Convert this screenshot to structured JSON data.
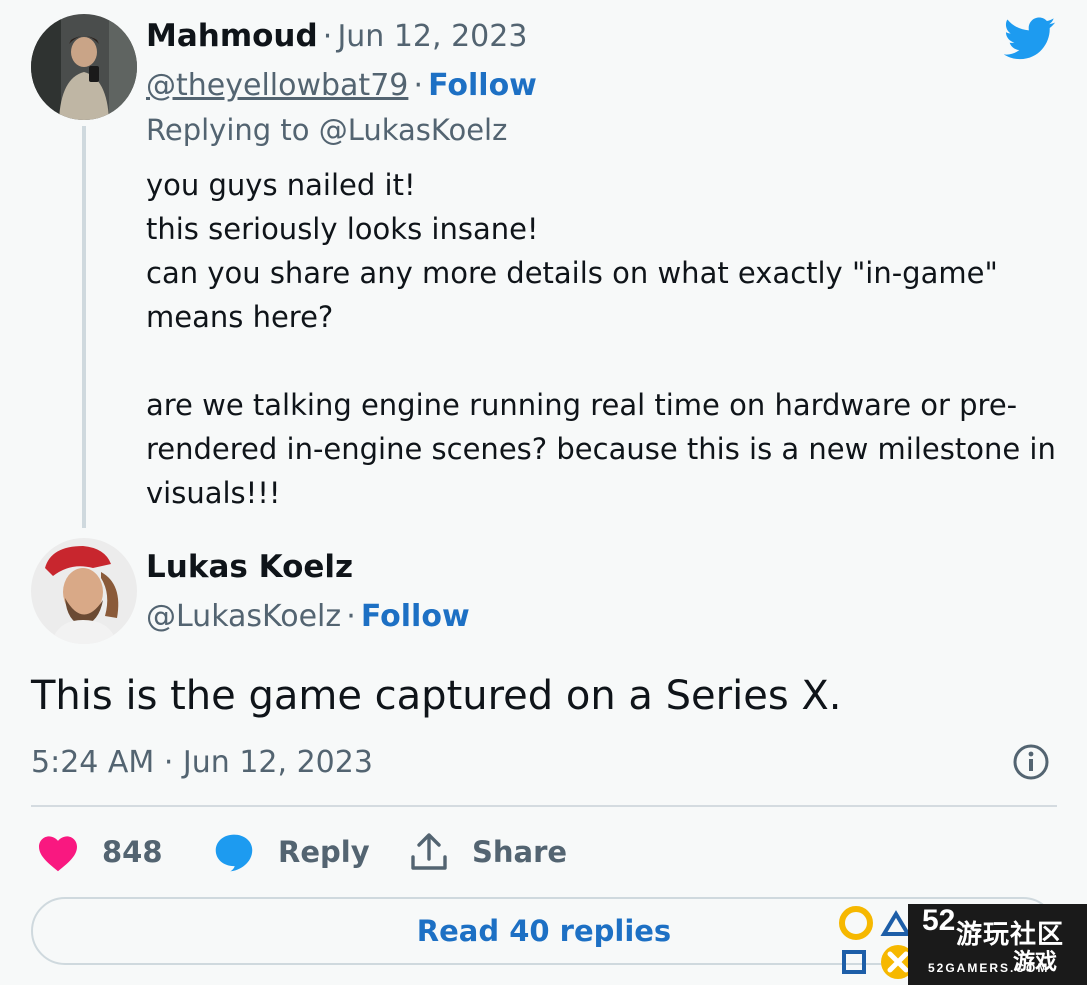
{
  "reply_tweet": {
    "author_name": "Mahmoud",
    "separator": "·",
    "date": "Jun 12, 2023",
    "handle": "@theyellowbat79",
    "follow_label": "Follow",
    "replying_to": "Replying to @LukasKoelz",
    "body_lines": [
      "you guys nailed it!",
      "this seriously looks insane!",
      "can you share any more details on what exactly \"in-game\"",
      "means here?",
      "",
      "are we talking engine running real time on hardware or pre-",
      "rendered in-engine scenes? because this is a new milestone in",
      "visuals!!!"
    ]
  },
  "main_tweet": {
    "author_name": "Lukas Koelz",
    "handle": "@LukasKoelz",
    "separator": "·",
    "follow_label": "Follow",
    "text": "This is the game captured on a Series X.",
    "timestamp": "5:24 AM · Jun 12, 2023"
  },
  "actions": {
    "like_count": "848",
    "reply_label": "Reply",
    "share_label": "Share"
  },
  "read_replies_label": "Read 40 replies",
  "watermark": {
    "number": "52",
    "name_cn": "游玩社区",
    "name_cn2": "游戏",
    "site": "52GAMERS.COM"
  },
  "icons": {
    "brand": "twitter-bird-icon",
    "info": "info-icon",
    "like": "heart-icon",
    "reply": "speech-bubble-icon",
    "share": "share-upload-icon"
  },
  "colors": {
    "twitter_blue": "#1d9bf0",
    "link_blue": "#1d70c4",
    "heart_pink": "#f91880",
    "reply_blue": "#1d9bf0",
    "muted_text": "#536471",
    "background": "#f7f9f9"
  }
}
